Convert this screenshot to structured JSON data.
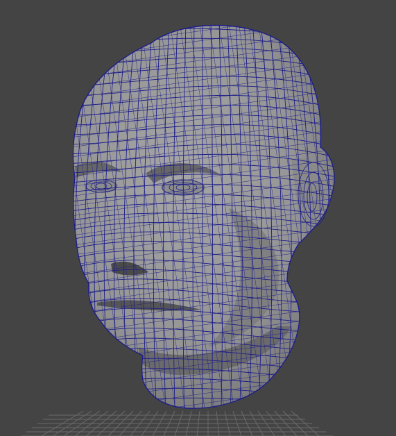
{
  "viewport": {
    "background_color": "#444444",
    "grid_color": "#6a6a6a",
    "mesh_fill_color": "#9a9a9a",
    "mesh_shadow_color": "#5f5f5f",
    "wireframe_color": "#1e1e8a"
  },
  "model": {
    "type": "polygon-mesh",
    "display_mode": "wireframe-on-shaded",
    "subject": "human head"
  }
}
